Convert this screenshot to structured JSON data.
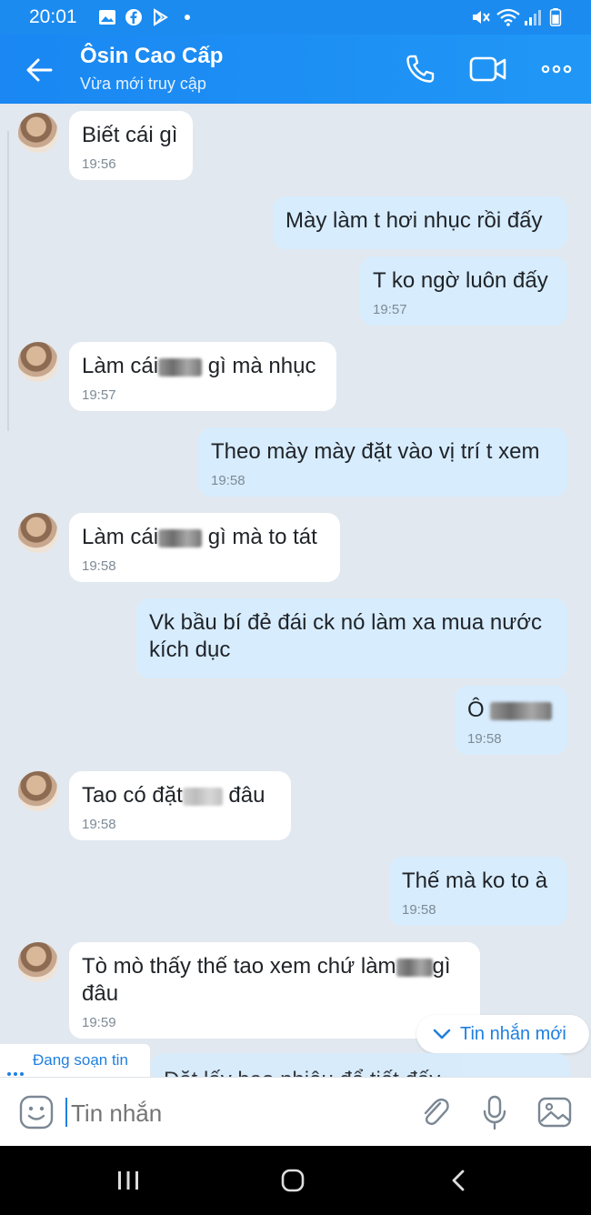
{
  "status_bar": {
    "time": "20:01"
  },
  "header": {
    "contact_name": "Ôsin Cao Cấp",
    "contact_status": "Vừa mới truy cập"
  },
  "messages": [
    {
      "direction": "in",
      "text": "Biết cái gì",
      "time": "19:56"
    },
    {
      "direction": "out",
      "text": "Mày làm t hơi nhục rồi đấy",
      "time": ""
    },
    {
      "direction": "out",
      "text": "T ko ngờ luôn đấy",
      "time": "19:57"
    },
    {
      "direction": "in",
      "text_before": "Làm cái",
      "text_after": " gì mà nhục",
      "time": "19:57"
    },
    {
      "direction": "out",
      "text": "Theo mày mày đặt vào vị trí t xem",
      "time": "19:58"
    },
    {
      "direction": "in",
      "text_before": "Làm cái",
      "text_after": " gì mà to tát",
      "time": "19:58"
    },
    {
      "direction": "out",
      "text": "Vk bầu bí đẻ đái ck nó làm xa mua nước\nkích dục",
      "time": ""
    },
    {
      "direction": "out",
      "text_before": "Ô",
      "text_after": "",
      "time": "19:58"
    },
    {
      "direction": "in",
      "text_before": "Tao có đặt",
      "text_after": " đâu",
      "time": "19:58"
    },
    {
      "direction": "out",
      "text": "Thế mà ko to à",
      "time": "19:58"
    },
    {
      "direction": "in",
      "text_before": "Tò mò thấy thế tao xem chứ làm",
      "text_after": "gì",
      "text_line2": "đâu",
      "time": "19:59"
    }
  ],
  "new_message_pill": "Tin nhắn mới",
  "typing_indicator": "Đang soạn tin",
  "partial_message": "Đặt lấy bao nhiêu để tiết đấy",
  "input": {
    "placeholder": "Tin nhắn"
  },
  "icons": {
    "status_left": [
      "gallery-icon",
      "facebook-icon",
      "play-store-icon"
    ],
    "status_right": [
      "mute-icon",
      "wifi-icon",
      "signal-icon",
      "battery-icon"
    ],
    "header": [
      "back-arrow-icon",
      "phone-icon",
      "video-call-icon",
      "more-icon"
    ],
    "input_bar": [
      "sticker-icon",
      "attach-icon",
      "microphone-icon",
      "image-icon"
    ],
    "nav": [
      "recents-icon",
      "home-icon",
      "back-icon"
    ]
  },
  "colors": {
    "header": "#1b8bf0",
    "incoming_bubble": "#ffffff",
    "outgoing_bubble": "#d7ecfd",
    "accent": "#1f7fe0"
  }
}
